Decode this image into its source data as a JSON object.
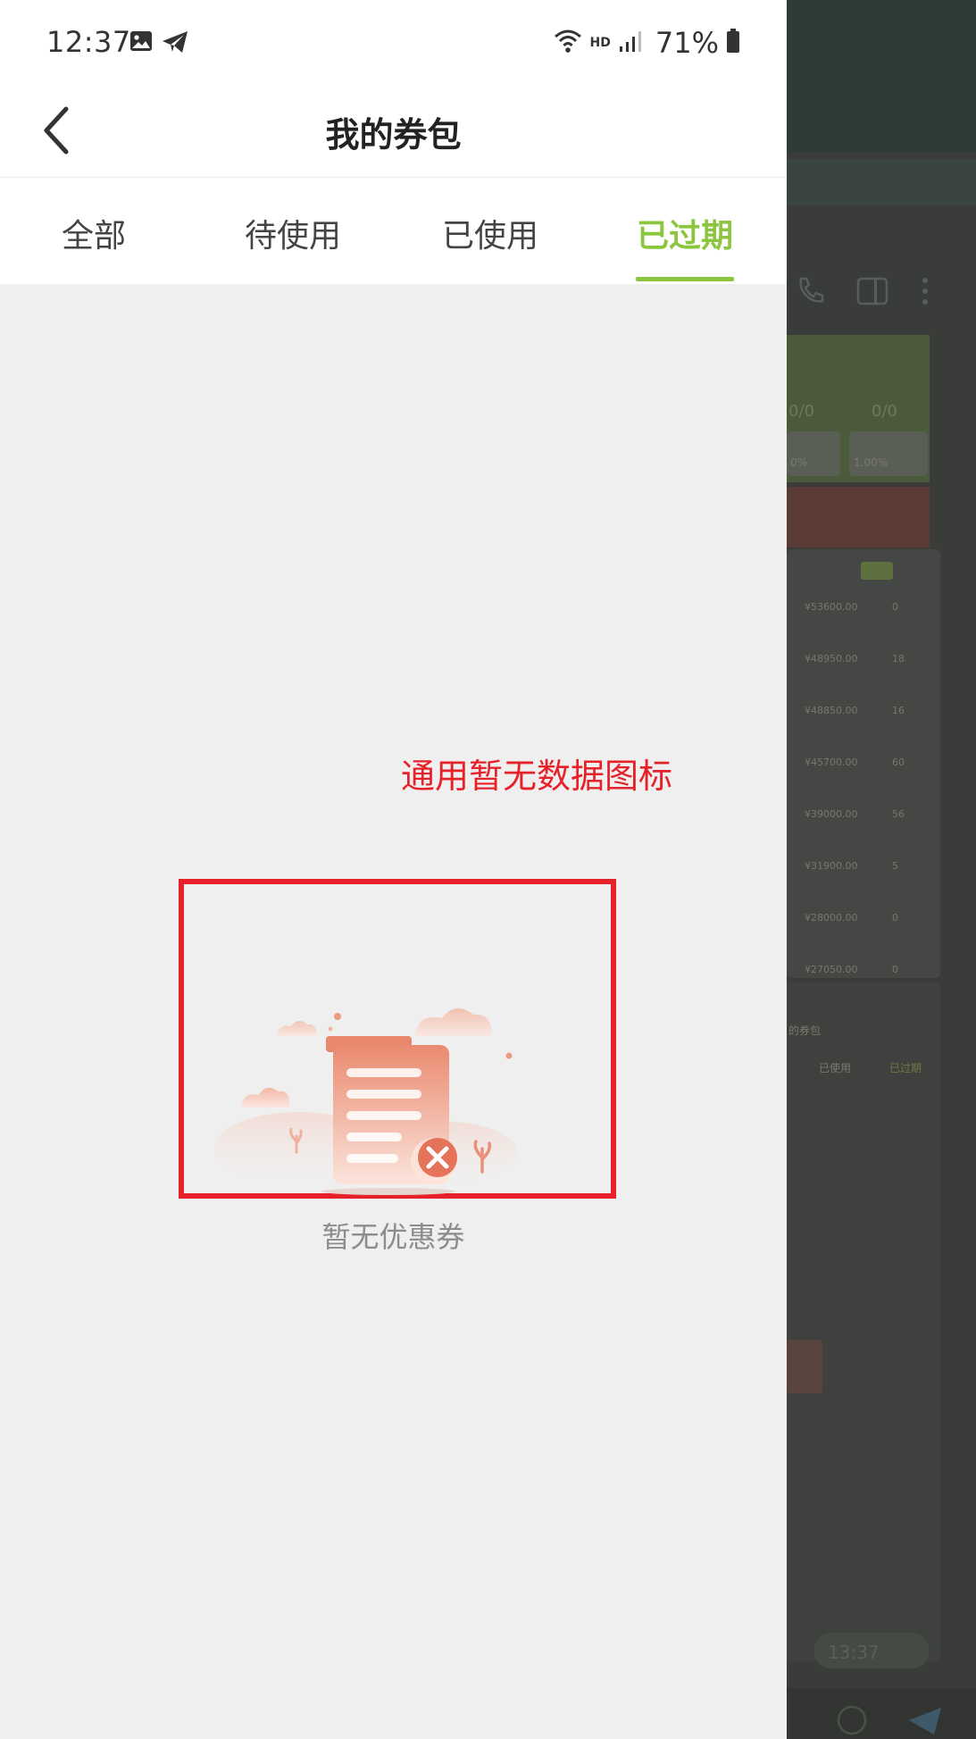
{
  "status_bar": {
    "time": "12:37",
    "hd": "HD",
    "battery": "71%"
  },
  "header": {
    "title": "我的券包"
  },
  "tabs": [
    {
      "label": "全部",
      "active": false
    },
    {
      "label": "待使用",
      "active": false
    },
    {
      "label": "已使用",
      "active": false
    },
    {
      "label": "已过期",
      "active": true
    }
  ],
  "accent_color": "#8cc63f",
  "annotation": {
    "label": "通用暂无数据图标",
    "color": "#e6212a"
  },
  "empty_state": {
    "icon": "empty-coupon-clipboard-icon",
    "text": "暂无优惠券"
  },
  "background_app": {
    "stats": [
      "0/0",
      "0/0"
    ],
    "small_boxes": [
      "0%",
      "1.00%"
    ],
    "rows": [
      {
        "amount": "¥53600.00",
        "count": "0"
      },
      {
        "amount": "¥48950.00",
        "count": "18"
      },
      {
        "amount": "¥48850.00",
        "count": "16"
      },
      {
        "amount": "¥45700.00",
        "count": "60"
      },
      {
        "amount": "¥39000.00",
        "count": "56"
      },
      {
        "amount": "¥31900.00",
        "count": "5"
      },
      {
        "amount": "¥28000.00",
        "count": "0"
      },
      {
        "amount": "¥27050.00",
        "count": "0"
      }
    ],
    "mini_title": "的券包",
    "mini_tabs": [
      "已使用",
      "已过期"
    ],
    "chat_time": "13:37"
  }
}
